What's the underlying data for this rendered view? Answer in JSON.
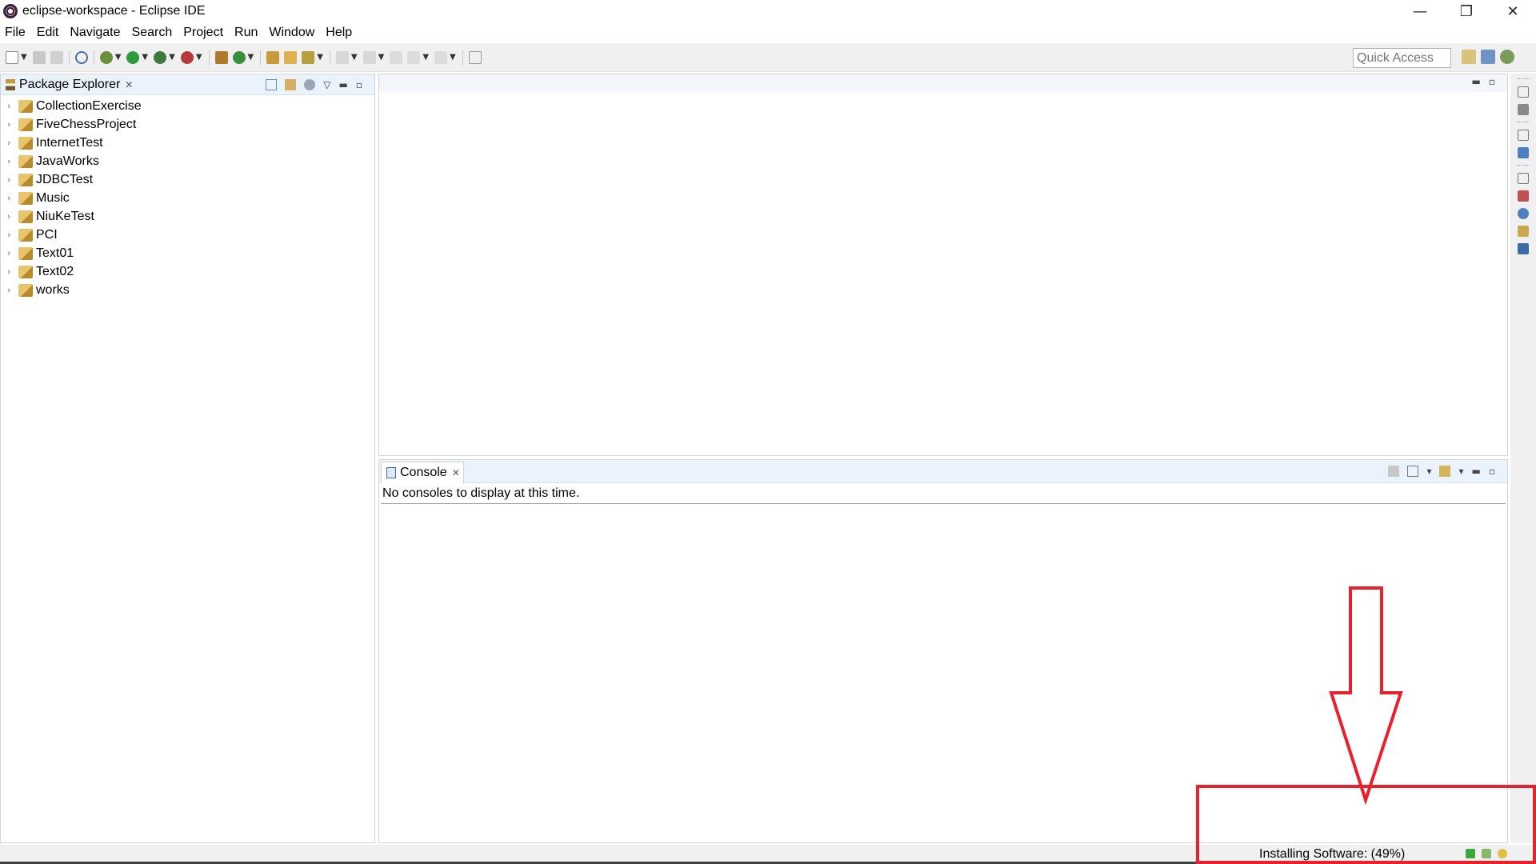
{
  "window": {
    "title": "eclipse-workspace - Eclipse IDE",
    "minimize": "—",
    "maximize": "❐",
    "close": "✕"
  },
  "menu": {
    "items": [
      "File",
      "Edit",
      "Navigate",
      "Search",
      "Project",
      "Run",
      "Window",
      "Help"
    ]
  },
  "toolbar": {
    "quick_access_placeholder": "Quick Access"
  },
  "package_explorer": {
    "tab_label": "Package Explorer",
    "projects": [
      "CollectionExercise",
      "FiveChessProject",
      "InternetTest",
      "JavaWorks",
      "JDBCTest",
      "Music",
      "NiuKeTest",
      "PCI",
      "Text01",
      "Text02",
      "works"
    ]
  },
  "console": {
    "tab_label": "Console",
    "message": "No consoles to display at this time."
  },
  "status": {
    "text": "Installing Software: (49%)",
    "progress_fraction": 0.49
  },
  "colors": {
    "annotation": "#e8202a",
    "view_header": "#eaf2fb",
    "chrome": "#f0f0f0"
  },
  "icons": {
    "app": "eclipse-icon",
    "project": "java-project-icon",
    "console": "console-icon"
  }
}
